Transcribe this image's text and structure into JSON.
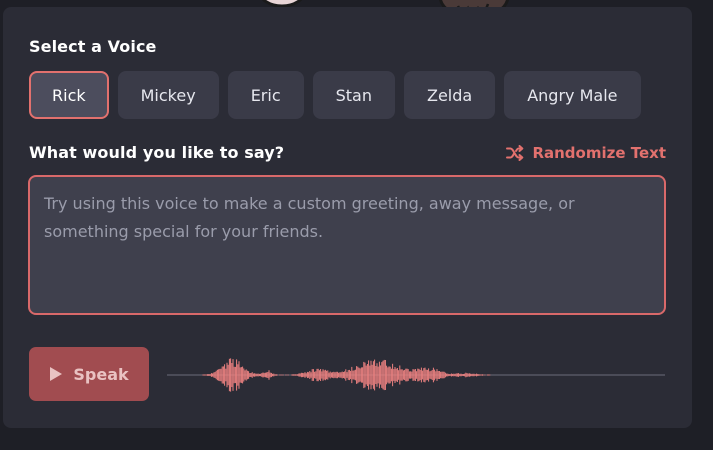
{
  "voice_section": {
    "label": "Select a Voice",
    "voices": [
      "Rick",
      "Mickey",
      "Eric",
      "Stan",
      "Zelda",
      "Angry Male"
    ],
    "selected": "Rick"
  },
  "message_section": {
    "label": "What would you like to say?",
    "randomize_label": "Randomize Text",
    "placeholder": "Try using this voice to make a custom greeting, away message, or something special for your friends."
  },
  "player": {
    "speak_label": "Speak"
  },
  "colors": {
    "accent": "#e2716e",
    "card_bg": "#2b2c36",
    "page_bg": "#1e1f26",
    "waveform": "#ee8281"
  },
  "icons": {
    "randomize": "shuffle-icon",
    "speak": "play-icon"
  }
}
